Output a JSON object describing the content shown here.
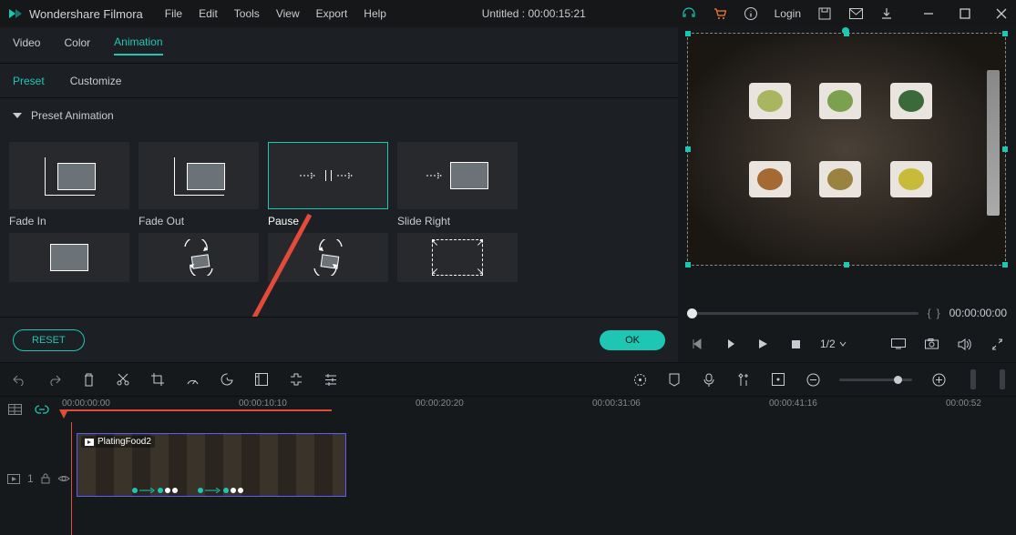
{
  "app": {
    "name": "Wondershare Filmora"
  },
  "menu": {
    "file": "File",
    "edit": "Edit",
    "tools": "Tools",
    "view": "View",
    "export": "Export",
    "help": "Help"
  },
  "title": "Untitled : 00:00:15:21",
  "login": "Login",
  "tabs": {
    "video": "Video",
    "color": "Color",
    "animation": "Animation"
  },
  "subtabs": {
    "preset": "Preset",
    "customize": "Customize"
  },
  "section": {
    "preset_animation": "Preset Animation"
  },
  "presets": {
    "fade_in": "Fade In",
    "fade_out": "Fade Out",
    "pause": "Pause",
    "slide_right": "Slide Right"
  },
  "buttons": {
    "reset": "RESET",
    "ok": "OK"
  },
  "preview": {
    "time": "00:00:00:00"
  },
  "transport": {
    "speed": "1/2"
  },
  "timeline": {
    "marks": [
      "00:00:00:00",
      "00:00:10:10",
      "00:00:20:20",
      "00:00:31:06",
      "00:00:41:16",
      "00:00:52"
    ],
    "clip_name": "PlatingFood2"
  },
  "track_label": "1"
}
